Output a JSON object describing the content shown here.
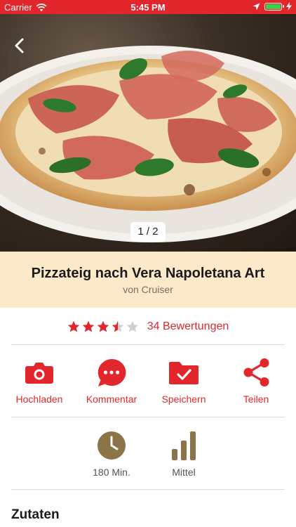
{
  "status_bar": {
    "carrier": "Carrier",
    "time": "5:45 PM",
    "battery_level": 1.0
  },
  "hero": {
    "pager": "1 / 2"
  },
  "recipe": {
    "title": "Pizzateig nach Vera Napoletana Art",
    "author": "von Cruiser"
  },
  "rating": {
    "stars": 3.5,
    "max_stars": 5,
    "count_label": "34 Bewertungen"
  },
  "actions": [
    {
      "label": "Hochladen",
      "icon": "camera-icon"
    },
    {
      "label": "Kommentar",
      "icon": "comment-icon"
    },
    {
      "label": "Speichern",
      "icon": "folder-check-icon"
    },
    {
      "label": "Teilen",
      "icon": "share-icon"
    }
  ],
  "meta": {
    "time_label": "180 Min.",
    "difficulty_label": "Mittel"
  },
  "sections": {
    "ingredients_title": "Zutaten"
  },
  "colors": {
    "accent": "#e2262c",
    "band": "#fbe9c9",
    "meta_icon": "#8a7448",
    "star_empty": "#cfcfcf"
  }
}
